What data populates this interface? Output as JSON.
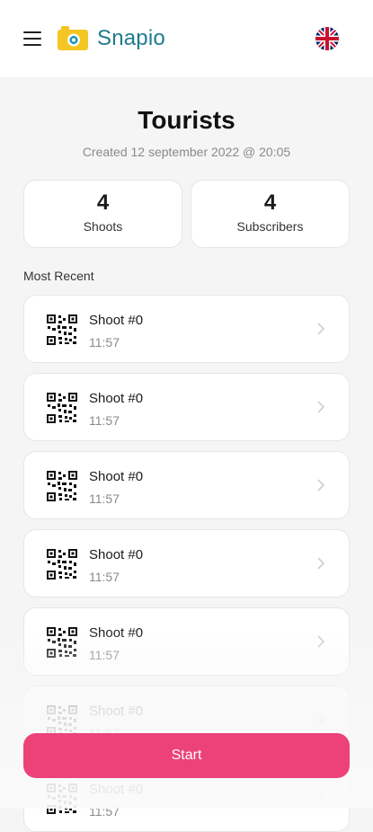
{
  "header": {
    "brand": "Snapio",
    "logo_icon": "camera-logo-icon",
    "menu_icon": "hamburger-menu-icon",
    "language_icon": "uk-flag-icon",
    "brand_color": "#1f7a8c",
    "logo_color": "#f3c623"
  },
  "event": {
    "title": "Tourists",
    "created": "Created 12 september 2022 @ 20:05"
  },
  "stats": [
    {
      "value": "4",
      "label": "Shoots"
    },
    {
      "value": "4",
      "label": "Subscribers"
    }
  ],
  "section_title": "Most Recent",
  "shoots": [
    {
      "name": "Shoot #0",
      "time": "11:57"
    },
    {
      "name": "Shoot #0",
      "time": "11:57"
    },
    {
      "name": "Shoot #0",
      "time": "11:57"
    },
    {
      "name": "Shoot #0",
      "time": "11:57"
    },
    {
      "name": "Shoot #0",
      "time": "11:57"
    },
    {
      "name": "Shoot #0",
      "time": "11:57"
    },
    {
      "name": "Shoot #0",
      "time": "11:57"
    }
  ],
  "start_button": {
    "label": "Start",
    "color": "#ec4278"
  }
}
